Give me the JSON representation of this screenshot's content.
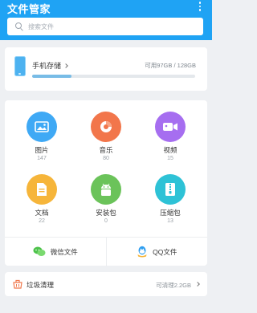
{
  "header": {
    "title": "文件管家",
    "search_placeholder": "搜索文件"
  },
  "storage": {
    "title": "手机存储",
    "usage_text": "可用97GB / 128GB",
    "used_fraction": 0.24
  },
  "categories": [
    {
      "label": "图片",
      "count": "147",
      "icon": "image-icon",
      "color": "#3fa9f5"
    },
    {
      "label": "音乐",
      "count": "80",
      "icon": "music-icon",
      "color": "#f2764b"
    },
    {
      "label": "视频",
      "count": "15",
      "icon": "video-icon",
      "color": "#a66ef0"
    },
    {
      "label": "文档",
      "count": "22",
      "icon": "document-icon",
      "color": "#f6b53a"
    },
    {
      "label": "安装包",
      "count": "0",
      "icon": "android-package-icon",
      "color": "#6bc35a"
    },
    {
      "label": "压缩包",
      "count": "13",
      "icon": "zip-icon",
      "color": "#2ec2d6"
    }
  ],
  "quick_links": {
    "wechat": "微信文件",
    "qq": "QQ文件"
  },
  "cleanup": {
    "label": "垃圾清理",
    "value": "可清理2.2GB"
  },
  "colors": {
    "header_bg": "#1fa3f4",
    "accent": "#78bce6"
  }
}
